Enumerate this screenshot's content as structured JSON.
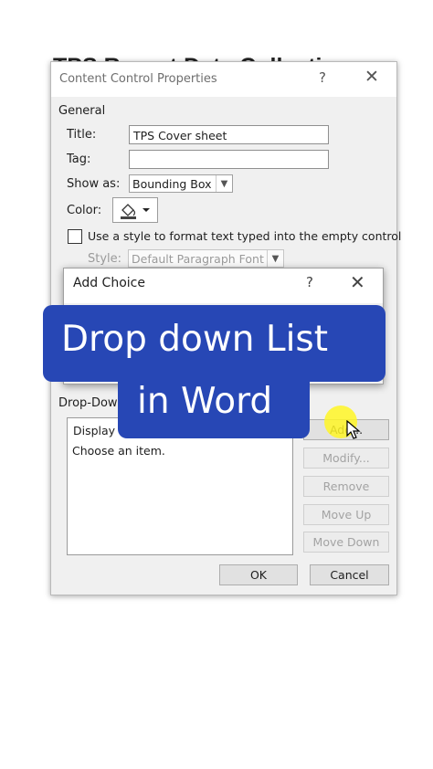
{
  "background_heading": "TPS Report Data Collection",
  "dialog": {
    "title": "Content Control Properties",
    "help_glyph": "?",
    "close_glyph": "✕",
    "general_section": "General",
    "title_label": "Title:",
    "title_value": "TPS Cover sheet",
    "tag_label": "Tag:",
    "tag_value": "",
    "show_as_label": "Show as:",
    "show_as_value": "Bounding Box",
    "color_label": "Color:",
    "use_style_label": "Use a style to format text typed into the empty control",
    "style_label": "Style:",
    "style_value": "Default Paragraph Font",
    "dropdown_section": "Drop-Down List Properties",
    "list_header": "Display Name",
    "list_items": [
      "Choose an item."
    ],
    "buttons": {
      "add": "Add...",
      "modify": "Modify...",
      "remove": "Remove",
      "move_up": "Move Up",
      "move_down": "Move Down",
      "ok": "OK",
      "cancel": "Cancel"
    }
  },
  "add_choice": {
    "title": "Add Choice",
    "help_glyph": "?",
    "close_glyph": "✕"
  },
  "overlay": {
    "line1": "Drop down List",
    "line2": "in Word",
    "banner_color": "#2747b5",
    "highlight_color": "#fff626"
  }
}
